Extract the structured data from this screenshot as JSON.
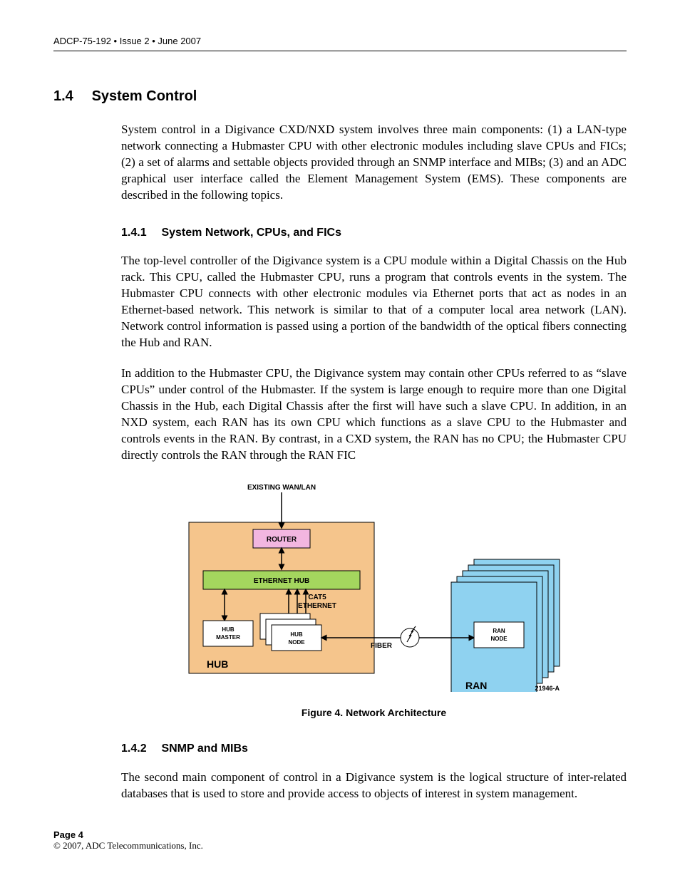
{
  "header": {
    "label": "ADCP-75-192 • Issue 2 • June 2007"
  },
  "section": {
    "number": "1.4",
    "title": "System Control",
    "intro": "System control in a Digivance CXD/NXD system involves three main components: (1) a LAN-type network connecting a Hubmaster CPU with other electronic modules including slave CPUs and FICs; (2) a set of alarms and settable objects provided through an SNMP interface and MIBs; (3) and an ADC graphical user interface called the Element Management System (EMS). These components are described in the following topics.",
    "sub1": {
      "number": "1.4.1",
      "title": "System Network, CPUs, and FICs",
      "p1": "The top-level controller of the Digivance system is a CPU module within a Digital Chassis on the Hub rack. This CPU, called the Hubmaster CPU, runs a program that controls events in the system. The Hubmaster CPU connects with other electronic modules via Ethernet ports that act as nodes in an Ethernet-based network. This network is similar to that of a computer local area network (LAN). Network control information is passed using a portion of the bandwidth of the optical fibers connecting the Hub and RAN.",
      "p2": "In addition to the Hubmaster CPU, the Digivance system may contain other CPUs referred to as “slave CPUs” under control of the Hubmaster. If the system is large enough to require more than one Digital Chassis in the Hub, each Digital Chassis after the first will have such a slave CPU. In addition, in an NXD system, each RAN has its own CPU which functions as a slave CPU to the Hubmaster and controls events in the RAN. By contrast, in a CXD system, the RAN has no CPU; the Hubmaster CPU directly controls the RAN through the RAN FIC"
    },
    "figure": {
      "wan": "EXISTING WAN/LAN",
      "router": "ROUTER",
      "ehub": "ETHERNET HUB",
      "cat5a": "CAT5",
      "cat5b": "ETHERNET",
      "hmaster1": "HUB",
      "hmaster2": "MASTER",
      "hnode1": "HUB",
      "hnode2": "NODE",
      "rnode1": "RAN",
      "rnode2": "NODE",
      "hub": "HUB",
      "ran": "RAN",
      "fiber": "FIBER",
      "id": "21946-A",
      "caption": "Figure 4. Network Architecture"
    },
    "sub2": {
      "number": "1.4.2",
      "title": "SNMP and MIBs",
      "p1": "The second main component of control in a Digivance system is the logical structure of inter-related databases that is used to store and provide access to objects of interest in system management."
    }
  },
  "footer": {
    "page": "Page 4",
    "copy": "© 2007, ADC Telecommunications, Inc."
  }
}
